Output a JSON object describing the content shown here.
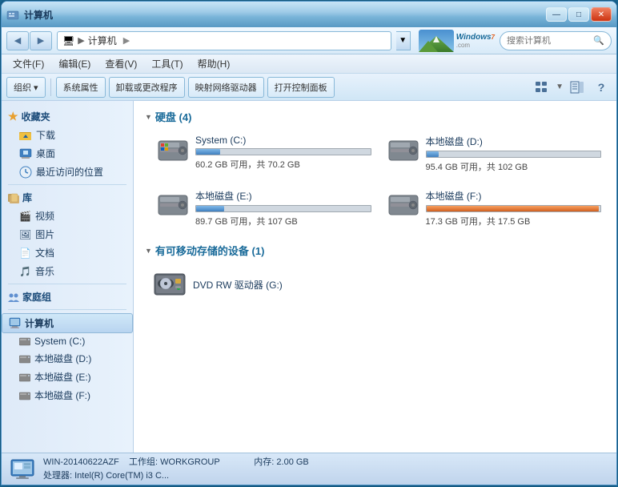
{
  "window": {
    "title": "计算机",
    "controls": {
      "minimize": "—",
      "maximize": "□",
      "close": "✕"
    }
  },
  "navbar": {
    "back_tooltip": "后退",
    "forward_tooltip": "前进",
    "address": "计算机",
    "address_icon": "🖥",
    "search_placeholder": "搜索计算机"
  },
  "menubar": {
    "items": [
      "文件(F)",
      "编辑(E)",
      "查看(V)",
      "工具(T)",
      "帮助(H)"
    ]
  },
  "toolbar": {
    "organize_label": "组织 ▾",
    "system_props_label": "系统属性",
    "uninstall_label": "卸载或更改程序",
    "map_drive_label": "映射网络驱动器",
    "open_panel_label": "打开控制面板",
    "view_options_label": "▤ ▾"
  },
  "sidebar": {
    "favorites_title": "收藏夹",
    "favorites_items": [
      {
        "label": "下载",
        "icon": "⬇"
      },
      {
        "label": "桌面",
        "icon": "🖥"
      },
      {
        "label": "最近访问的位置",
        "icon": "🕐"
      }
    ],
    "library_title": "库",
    "library_items": [
      {
        "label": "视频",
        "icon": "🎬"
      },
      {
        "label": "图片",
        "icon": "🖼"
      },
      {
        "label": "文档",
        "icon": "📄"
      },
      {
        "label": "音乐",
        "icon": "🎵"
      }
    ],
    "homegroup_title": "家庭组",
    "computer_title": "计算机",
    "computer_items": [
      {
        "label": "System (C:)",
        "icon": "💽"
      },
      {
        "label": "本地磁盘 (D:)",
        "icon": "💽"
      },
      {
        "label": "本地磁盘 (E:)",
        "icon": "💽"
      },
      {
        "label": "本地磁盘 (F:)",
        "icon": "💽"
      }
    ]
  },
  "hard_drives": {
    "section_title": "硬盘 (4)",
    "drives": [
      {
        "name": "System (C:)",
        "free_gb": 60.2,
        "total_gb": 70.2,
        "used_pct": 14,
        "bar_color": "normal",
        "size_text": "60.2 GB 可用，共 70.2 GB"
      },
      {
        "name": "本地磁盘 (D:)",
        "free_gb": 95.4,
        "total_gb": 102,
        "used_pct": 7,
        "bar_color": "normal",
        "size_text": "95.4 GB 可用，共 102 GB"
      },
      {
        "name": "本地磁盘 (E:)",
        "free_gb": 89.7,
        "total_gb": 107,
        "used_pct": 16,
        "bar_color": "normal",
        "size_text": "89.7 GB 可用，共 107 GB"
      },
      {
        "name": "本地磁盘 (F:)",
        "free_gb": 17.3,
        "total_gb": 17.5,
        "used_pct": 99,
        "bar_color": "low",
        "size_text": "17.3 GB 可用，共 17.5 GB"
      }
    ]
  },
  "removable": {
    "section_title": "有可移动存储的设备 (1)",
    "devices": [
      {
        "name": "DVD RW 驱动器 (G:)"
      }
    ]
  },
  "statusbar": {
    "pc_name": "WIN-20140622AZF",
    "workgroup_label": "工作组:",
    "workgroup": "WORKGROUP",
    "memory_label": "内存:",
    "memory": "2.00 GB",
    "cpu_label": "处理器:",
    "cpu": "Intel(R) Core(TM) i3 C..."
  },
  "colors": {
    "accent": "#1a6b9a",
    "bar_normal": "#4080c0",
    "bar_low": "#d06020",
    "sidebar_bg": "#deeaf8",
    "title_bar": "#a0cce8"
  }
}
